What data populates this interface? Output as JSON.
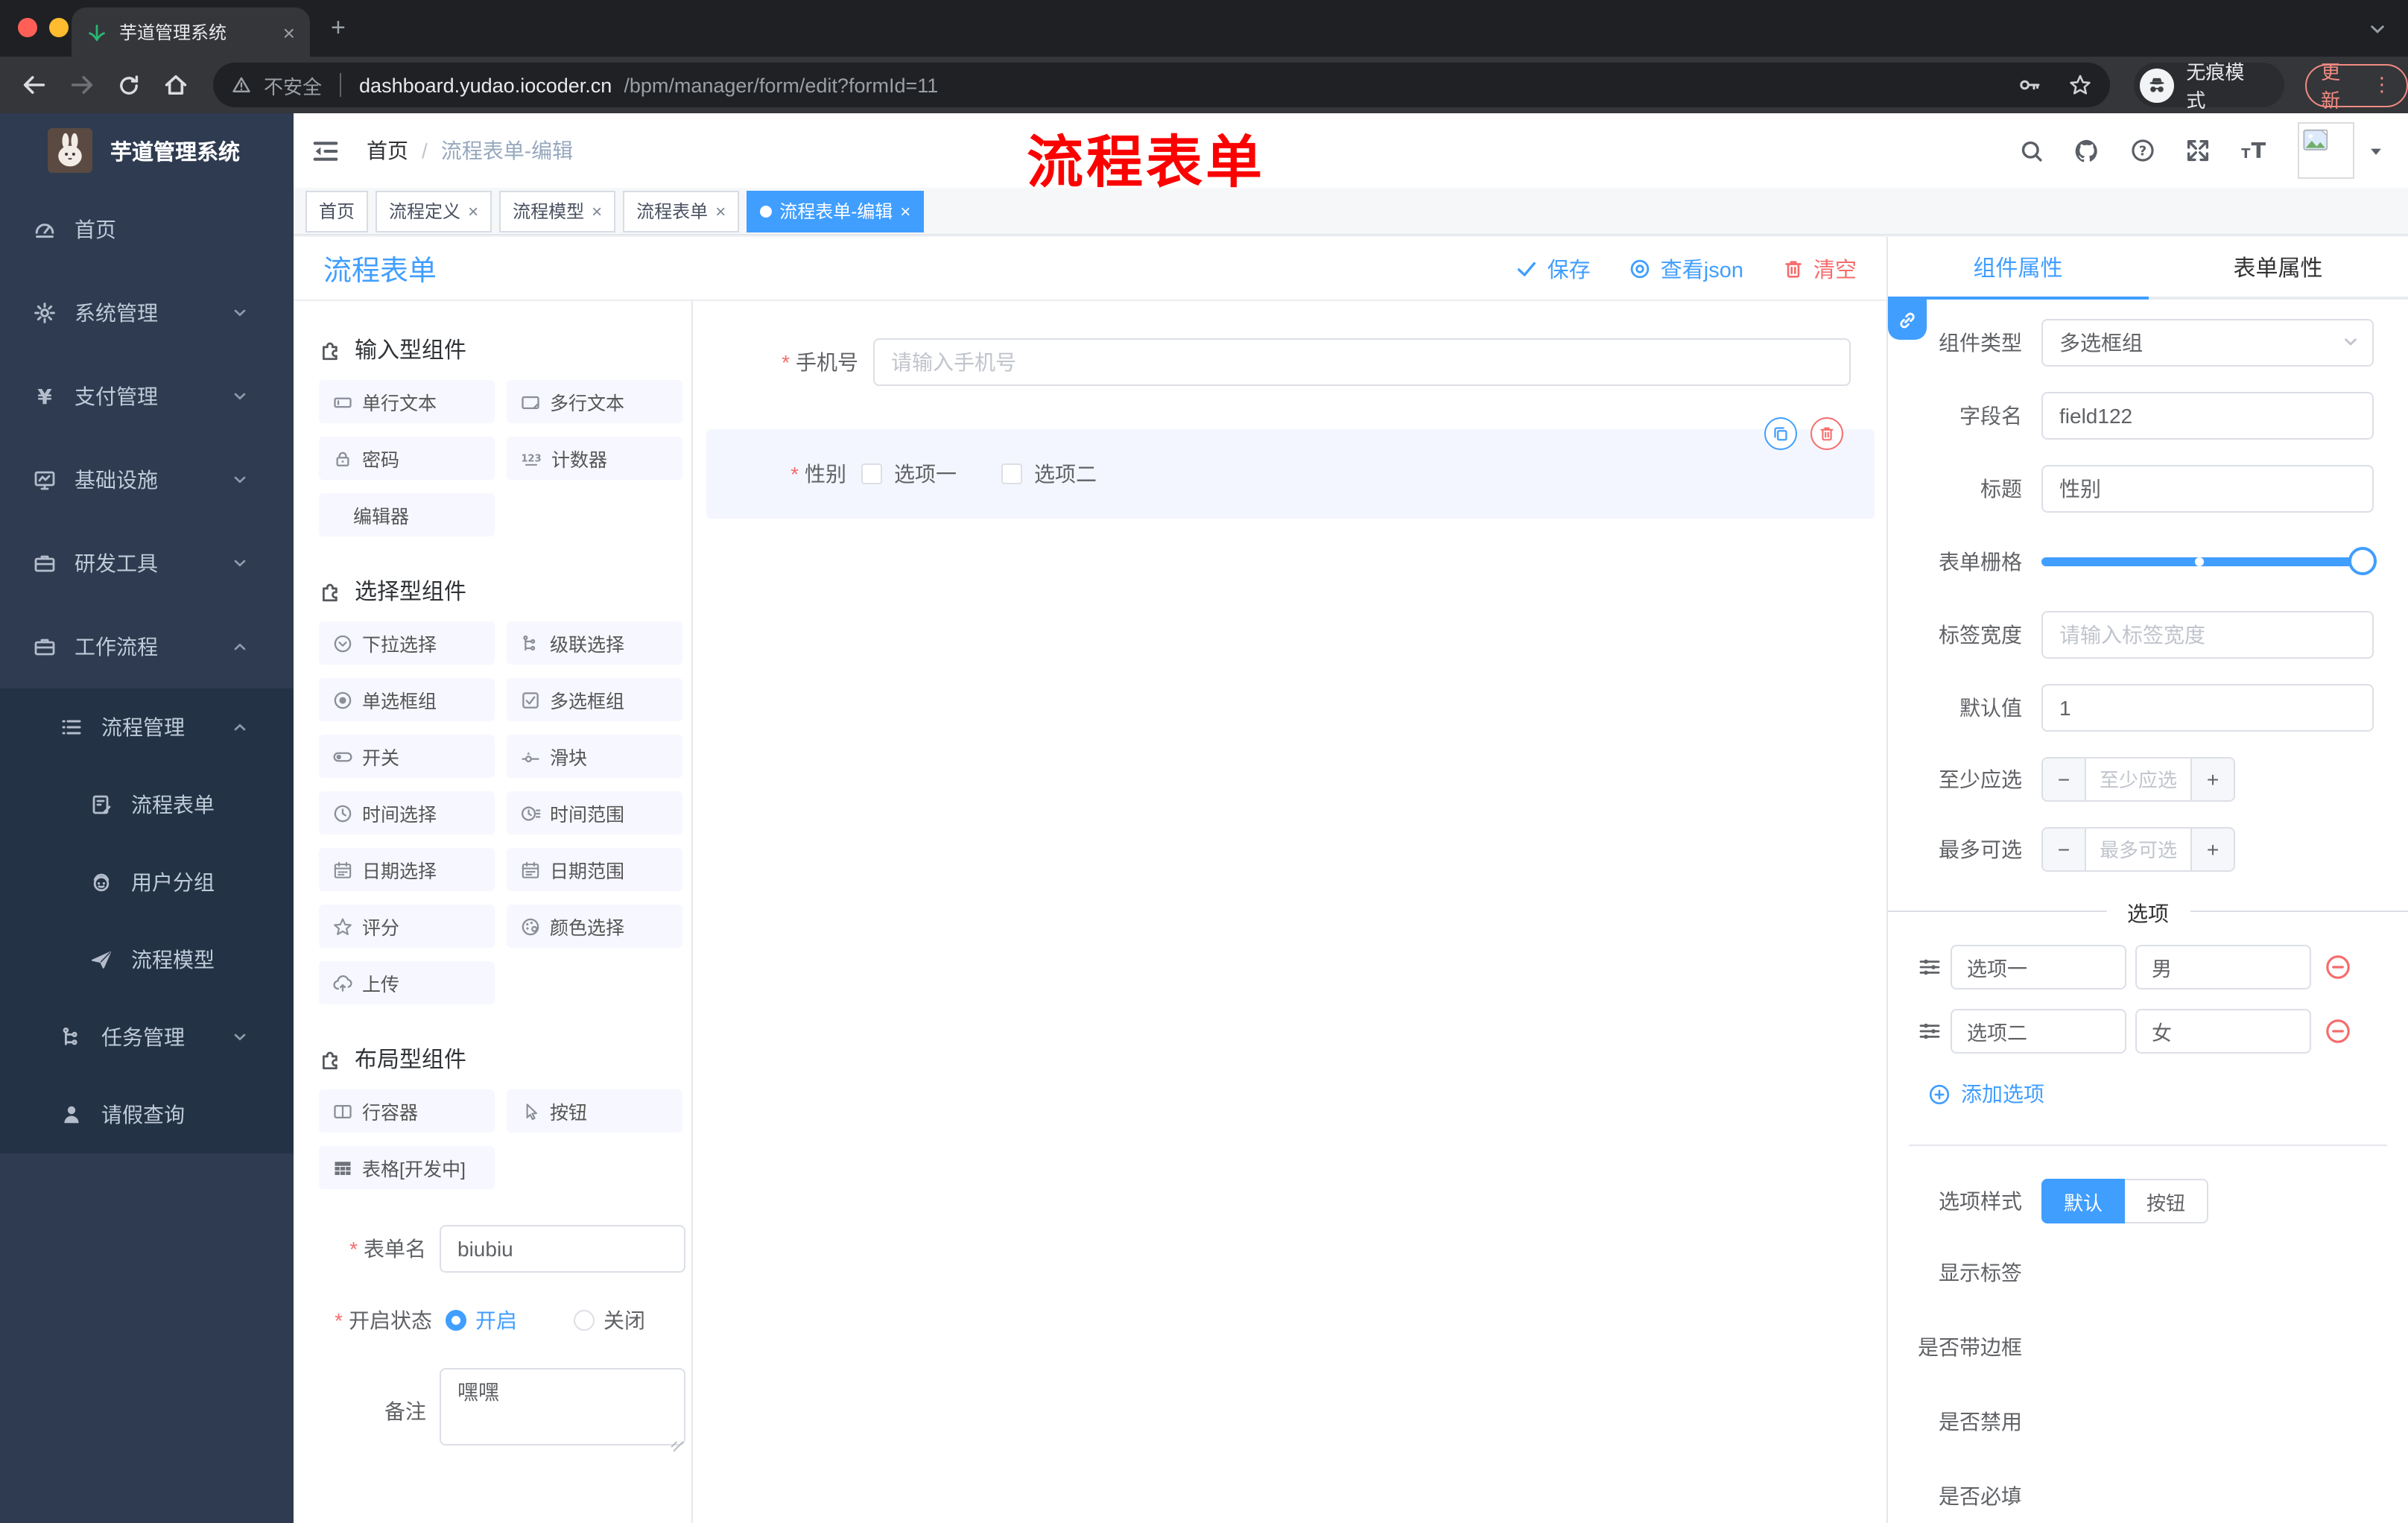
{
  "glyphs": {
    "close": "×",
    "plus": "+",
    "more": "⋮",
    "minus": "−",
    "slash": "/"
  },
  "browser": {
    "tab_title": "芋道管理系统",
    "security_label": "不安全",
    "url_host": "dashboard.yudao.iocoder.cn",
    "url_path": "/bpm/manager/form/edit?formId=11",
    "incognito_label": "无痕模式",
    "update_label": "更新"
  },
  "sidebar": {
    "app_title": "芋道管理系统",
    "items": [
      {
        "label": "首页"
      },
      {
        "label": "系统管理"
      },
      {
        "label": "支付管理"
      },
      {
        "label": "基础设施"
      },
      {
        "label": "研发工具"
      },
      {
        "label": "工作流程"
      },
      {
        "label": "流程管理"
      },
      {
        "label": "流程表单"
      },
      {
        "label": "用户分组"
      },
      {
        "label": "流程模型"
      },
      {
        "label": "任务管理"
      },
      {
        "label": "请假查询"
      }
    ]
  },
  "navbar": {
    "breadcrumb_home": "首页",
    "breadcrumb_current": "流程表单-编辑",
    "annotation": "流程表单"
  },
  "tags": [
    {
      "label": "首页"
    },
    {
      "label": "流程定义"
    },
    {
      "label": "流程模型"
    },
    {
      "label": "流程表单"
    },
    {
      "label": "流程表单-编辑"
    }
  ],
  "toolbar": {
    "title": "流程表单",
    "save": "保存",
    "view_json": "查看json",
    "clear": "清空"
  },
  "palette": {
    "sections": [
      {
        "title": "输入型组件",
        "items": [
          {
            "label": "单行文本"
          },
          {
            "label": "多行文本"
          },
          {
            "label": "密码"
          },
          {
            "label": "计数器"
          },
          {
            "label": "编辑器"
          }
        ]
      },
      {
        "title": "选择型组件",
        "items": [
          {
            "label": "下拉选择"
          },
          {
            "label": "级联选择"
          },
          {
            "label": "单选框组"
          },
          {
            "label": "多选框组"
          },
          {
            "label": "开关"
          },
          {
            "label": "滑块"
          },
          {
            "label": "时间选择"
          },
          {
            "label": "时间范围"
          },
          {
            "label": "日期选择"
          },
          {
            "label": "日期范围"
          },
          {
            "label": "评分"
          },
          {
            "label": "颜色选择"
          },
          {
            "label": "上传"
          }
        ]
      },
      {
        "title": "布局型组件",
        "items": [
          {
            "label": "行容器"
          },
          {
            "label": "按钮"
          },
          {
            "label": "表格[开发中]"
          }
        ]
      }
    ],
    "meta": {
      "name_label": "表单名",
      "name_value": "biubiu",
      "status_label": "开启状态",
      "status_on": "开启",
      "status_off": "关闭",
      "remark_label": "备注",
      "remark_value": "嘿嘿"
    }
  },
  "canvas": {
    "phone_label": "手机号",
    "phone_placeholder": "请输入手机号",
    "gender_label": "性别",
    "gender_options": [
      {
        "label": "选项一"
      },
      {
        "label": "选项二"
      }
    ]
  },
  "inspector": {
    "tab_component": "组件属性",
    "tab_form": "表单属性",
    "component_type_label": "组件类型",
    "component_type_value": "多选框组",
    "field_name_label": "字段名",
    "field_name_value": "field122",
    "title_label": "标题",
    "title_value": "性别",
    "grid_label": "表单栅格",
    "label_width_label": "标签宽度",
    "label_width_placeholder": "请输入标签宽度",
    "default_label": "默认值",
    "default_value": "1",
    "min_label": "至少应选",
    "min_placeholder": "至少应选",
    "max_label": "最多可选",
    "max_placeholder": "最多可选",
    "options_title": "选项",
    "options": [
      {
        "label": "选项一",
        "value": "男"
      },
      {
        "label": "选项二",
        "value": "女"
      }
    ],
    "add_option": "添加选项",
    "style_label": "选项样式",
    "style_default": "默认",
    "style_button": "按钮",
    "show_label": "显示标签",
    "border_label": "是否带边框",
    "disabled_label": "是否禁用",
    "required_label": "是否必填"
  },
  "colors": {
    "primary": "#409EFF",
    "danger": "#F56C6C"
  }
}
